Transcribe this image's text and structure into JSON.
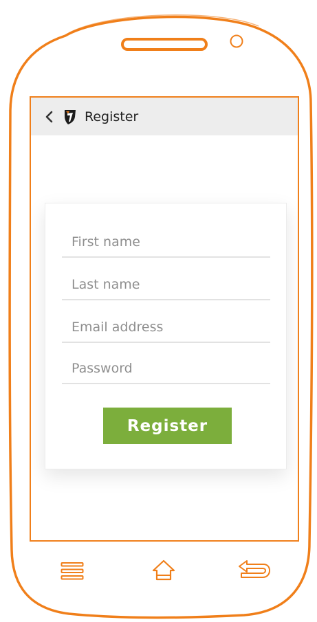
{
  "app_bar": {
    "title": "Register",
    "back_icon": "chevron-left-icon",
    "logo_icon": "brand-shield-icon"
  },
  "form": {
    "first_name": {
      "placeholder": "First name",
      "value": ""
    },
    "last_name": {
      "placeholder": "Last name",
      "value": ""
    },
    "email": {
      "placeholder": "Email address",
      "value": ""
    },
    "password": {
      "placeholder": "Password",
      "value": ""
    },
    "submit_label": "Register"
  },
  "nav_bar": {
    "menu_icon": "menu-icon",
    "home_icon": "home-icon",
    "back_icon": "back-arrow-icon"
  },
  "colors": {
    "accent_orange": "#f07f1a",
    "button_green": "#7cae3c",
    "app_bar_bg": "#ededed",
    "field_underline": "#e2e2e2",
    "placeholder_text": "#8e8e8e"
  }
}
